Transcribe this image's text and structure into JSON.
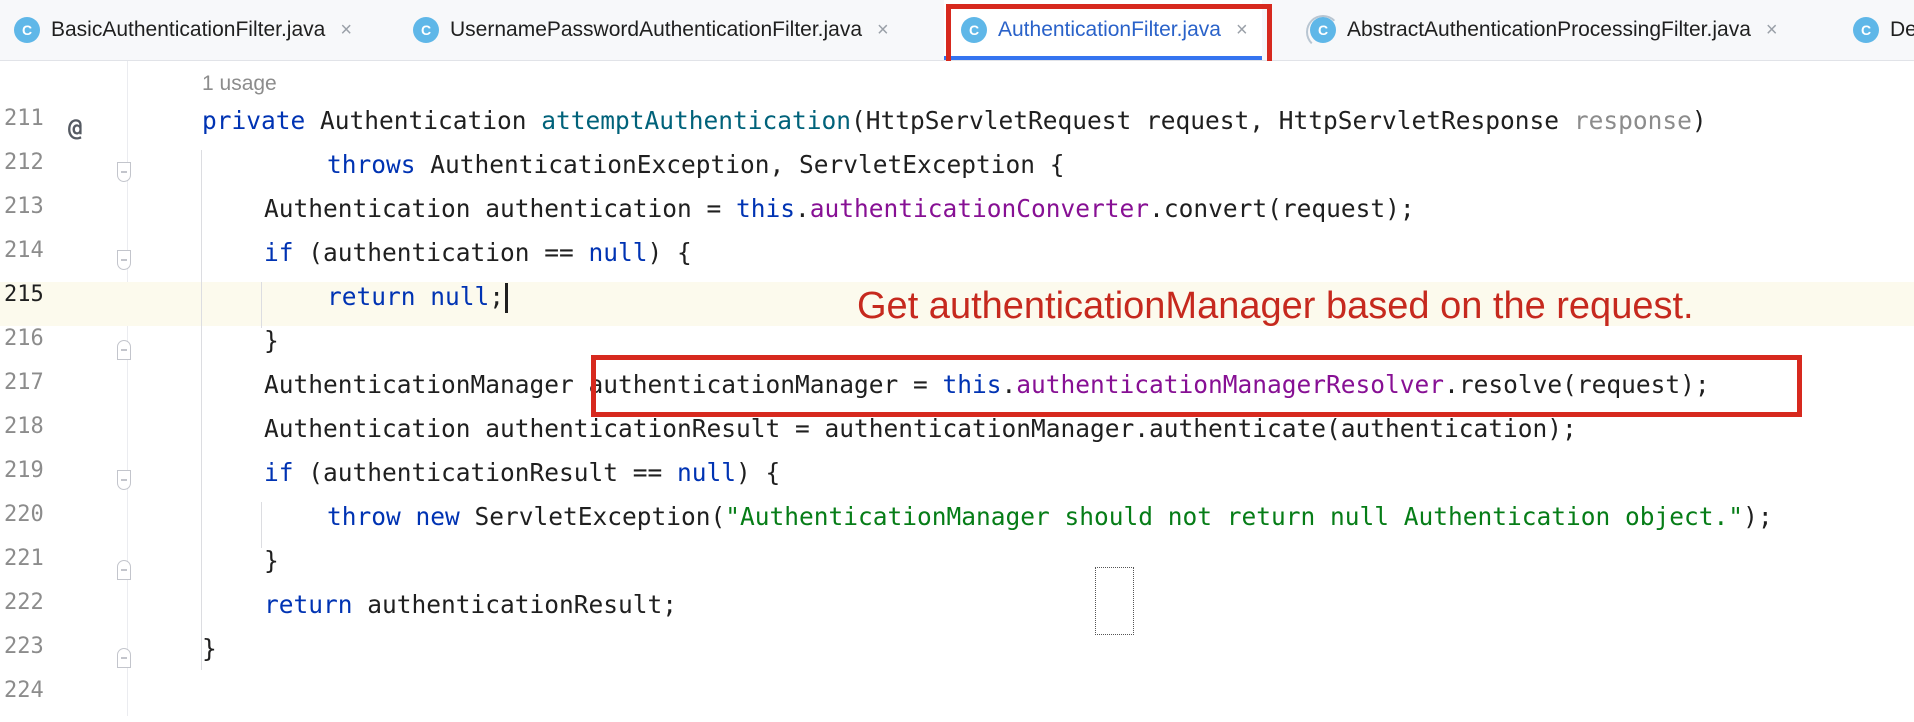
{
  "tabs": [
    {
      "icon": "C",
      "label": "BasicAuthenticationFilter.java",
      "close": "×"
    },
    {
      "icon": "C",
      "label": "UsernamePasswordAuthenticationFilter.java",
      "close": "×"
    },
    {
      "icon": "C",
      "label": "AuthenticationFilter.java",
      "close": "×",
      "active": true
    },
    {
      "icon": "C",
      "label": "AbstractAuthenticationProcessingFilter.java",
      "close": "×"
    },
    {
      "icon": "C",
      "label": "De"
    }
  ],
  "editor": {
    "usage_hint": "1 usage",
    "annotation": "Get authenticationManager based on the request.",
    "gutter_marker": "@",
    "lines": [
      {
        "num": "211",
        "t": [
          [
            "kw",
            "private "
          ],
          [
            "",
            "Authentication "
          ],
          [
            "m",
            "attemptAuthentication"
          ],
          [
            "",
            "(HttpServletRequest request, HttpServletResponse "
          ],
          [
            "p",
            "response"
          ],
          [
            "",
            ")"
          ]
        ]
      },
      {
        "num": "212",
        "t": [
          [
            "kw",
            "throws "
          ],
          [
            "",
            "AuthenticationException, ServletException {"
          ]
        ]
      },
      {
        "num": "213",
        "t": [
          [
            "",
            "Authentication authentication = "
          ],
          [
            "kw",
            "this"
          ],
          [
            "",
            "."
          ],
          [
            "f",
            "authenticationConverter"
          ],
          [
            "",
            ".convert(request);"
          ]
        ]
      },
      {
        "num": "214",
        "t": [
          [
            "kw",
            "if "
          ],
          [
            "",
            "(authentication == "
          ],
          [
            "kw",
            "null"
          ],
          [
            "",
            ") {"
          ]
        ]
      },
      {
        "num": "215",
        "t": [
          [
            "kw",
            "return null"
          ],
          [
            "",
            ";"
          ]
        ]
      },
      {
        "num": "216",
        "t": [
          [
            "",
            "}"
          ]
        ]
      },
      {
        "num": "217",
        "t": [
          [
            "",
            "AuthenticationManager authenticationManager = "
          ],
          [
            "kw",
            "this"
          ],
          [
            "",
            "."
          ],
          [
            "f",
            "authenticationManagerResolver"
          ],
          [
            "",
            ".resolve(request);"
          ]
        ]
      },
      {
        "num": "218",
        "t": [
          [
            "",
            "Authentication authenticationResult = authenticationManager.authenticate(authentication);"
          ]
        ]
      },
      {
        "num": "219",
        "t": [
          [
            "kw",
            "if "
          ],
          [
            "",
            "(authenticationResult == "
          ],
          [
            "kw",
            "null"
          ],
          [
            "",
            ") {"
          ]
        ]
      },
      {
        "num": "220",
        "t": [
          [
            "kw",
            "throw new "
          ],
          [
            "",
            "ServletException("
          ],
          [
            "s",
            "\"AuthenticationManager should not return null Authentication object.\""
          ],
          [
            "",
            ");"
          ]
        ]
      },
      {
        "num": "221",
        "t": [
          [
            "",
            "}"
          ]
        ]
      },
      {
        "num": "222",
        "t": [
          [
            "kw",
            "return "
          ],
          [
            "",
            "authenticationResult;"
          ]
        ]
      },
      {
        "num": "223",
        "t": [
          [
            "",
            "}"
          ]
        ]
      },
      {
        "num": "224",
        "t": []
      }
    ]
  },
  "colors": {
    "keyword": "#0033b3",
    "method": "#00627a",
    "field": "#871094",
    "string": "#067d17",
    "param_unused": "#8c8c8c",
    "highlight_box": "#d7291e",
    "annotation_text": "#c6291e",
    "active_tab_underline": "#3574f0"
  }
}
